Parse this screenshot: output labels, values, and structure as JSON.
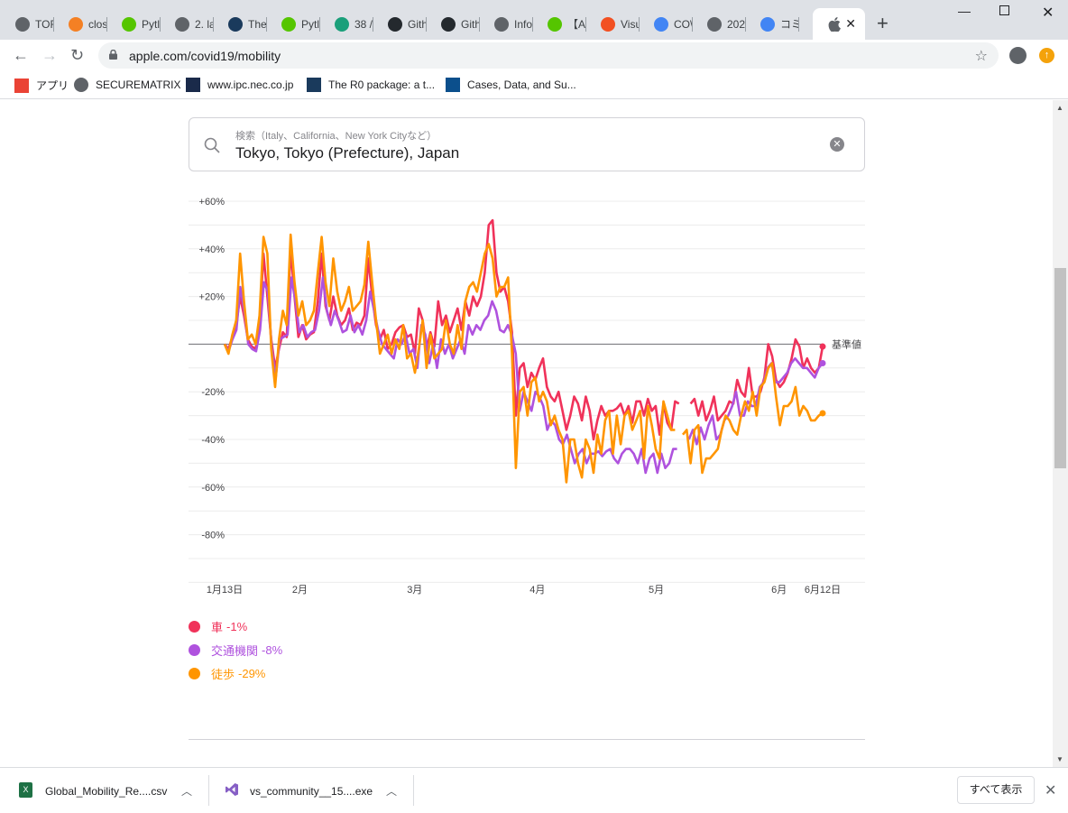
{
  "browser": {
    "tabs": [
      {
        "label": "TOF",
        "icon": "globe-icon",
        "color": "#5f6368"
      },
      {
        "label": "clos",
        "icon": "stackoverflow-icon",
        "color": "#f48024"
      },
      {
        "label": "Pytl",
        "icon": "qiita-icon",
        "color": "#55c500"
      },
      {
        "label": "2. la",
        "icon": "globe-icon",
        "color": "#5f6368"
      },
      {
        "label": "The",
        "icon": "r0-icon",
        "color": "#1a3a5c"
      },
      {
        "label": "Pytl",
        "icon": "qiita-icon",
        "color": "#55c500"
      },
      {
        "label": "38 /",
        "icon": "loading-icon",
        "color": "#1a9f7a"
      },
      {
        "label": "Gith",
        "icon": "github-icon",
        "color": "#24292e"
      },
      {
        "label": "Gith",
        "icon": "github-icon",
        "color": "#24292e"
      },
      {
        "label": "Info",
        "icon": "globe-icon",
        "color": "#5f6368"
      },
      {
        "label": "【Ai",
        "icon": "qiita-icon",
        "color": "#55c500"
      },
      {
        "label": "Visu",
        "icon": "microsoft-icon",
        "color": "#f25022"
      },
      {
        "label": "CO\\",
        "icon": "google-icon",
        "color": "#4285f4"
      },
      {
        "label": "202",
        "icon": "globe-icon",
        "color": "#5f6368"
      },
      {
        "label": "コミ",
        "icon": "google-icon",
        "color": "#4285f4"
      }
    ],
    "active_tab_icon": "apple-icon",
    "url": "apple.com/covid19/mobility",
    "bookmarks": [
      {
        "label": "アプリ",
        "icon": "apps-grid-icon"
      },
      {
        "label": "SECUREMATRIX",
        "icon": "globe-icon"
      },
      {
        "label": "www.ipc.nec.co.jp",
        "icon": "d-icon"
      },
      {
        "label": "The R0 package: a t...",
        "icon": "r0-icon"
      },
      {
        "label": "Cases, Data, and Su...",
        "icon": "cdc-icon"
      }
    ]
  },
  "search": {
    "placeholder": "検索（Italy、California、New York Cityなど）",
    "value": "Tokyo, Tokyo (Prefecture), Japan"
  },
  "chart_data": {
    "type": "line",
    "baseline_label": "基準値",
    "y_ticks": [
      "+60%",
      "+40%",
      "+20%",
      "",
      "-20%",
      "-40%",
      "-60%",
      "-80%"
    ],
    "ylim": [
      -100,
      60
    ],
    "x_ticks": [
      {
        "label": "1月13日",
        "date": "2020-01-13"
      },
      {
        "label": "2月",
        "date": "2020-02-01"
      },
      {
        "label": "3月",
        "date": "2020-03-01"
      },
      {
        "label": "4月",
        "date": "2020-04-01"
      },
      {
        "label": "5月",
        "date": "2020-05-01"
      },
      {
        "label": "6月",
        "date": "2020-06-01"
      },
      {
        "label": "6月12日",
        "date": "2020-06-12"
      }
    ],
    "x_start": "2020-01-13",
    "x_end": "2020-06-12",
    "series": [
      {
        "name": "車",
        "value_label": "-1%",
        "color": "#f0325a",
        "values": [
          0,
          -2,
          3,
          8,
          20,
          12,
          2,
          -1,
          -2,
          8,
          38,
          20,
          2,
          -10,
          -2,
          5,
          3,
          40,
          20,
          3,
          8,
          2,
          4,
          5,
          18,
          38,
          16,
          10,
          20,
          12,
          8,
          10,
          15,
          6,
          9,
          8,
          12,
          36,
          20,
          8,
          2,
          6,
          -2,
          0,
          5,
          7,
          8,
          3,
          4,
          -4,
          15,
          10,
          -2,
          5,
          -1,
          18,
          8,
          12,
          5,
          10,
          15,
          6,
          18,
          12,
          20,
          16,
          20,
          30,
          50,
          52,
          30,
          22,
          24,
          18,
          5,
          -30,
          -10,
          -8,
          -18,
          -12,
          -15,
          -10,
          -6,
          -18,
          -22,
          -24,
          -20,
          -28,
          -36,
          -30,
          -22,
          -25,
          -32,
          -22,
          -28,
          -40,
          -32,
          -26,
          -30,
          -28,
          -28,
          -27,
          -25,
          -30,
          -26,
          -33,
          -24,
          -24,
          -30,
          -23,
          -28,
          -26,
          -38,
          -25,
          -33,
          -36,
          -24,
          -25,
          null,
          null,
          -25,
          -23,
          -30,
          -24,
          -32,
          -28,
          -22,
          -32,
          -30,
          -28,
          -24,
          -25,
          -15,
          -20,
          -22,
          -10,
          -22,
          -22,
          -20,
          -14,
          0,
          -5,
          -15,
          -18,
          -16,
          -12,
          -6,
          2,
          -1,
          -10,
          -6,
          -10,
          -12,
          -10,
          -1
        ]
      },
      {
        "name": "交通機関",
        "value_label": "-8%",
        "color": "#af52de",
        "values": [
          0,
          -3,
          2,
          6,
          24,
          14,
          0,
          -2,
          -3,
          6,
          26,
          22,
          -2,
          -14,
          2,
          3,
          4,
          28,
          18,
          5,
          8,
          3,
          5,
          6,
          14,
          28,
          14,
          8,
          14,
          10,
          5,
          6,
          12,
          5,
          8,
          4,
          10,
          22,
          14,
          6,
          0,
          -2,
          -4,
          -6,
          2,
          0,
          4,
          -4,
          -2,
          -10,
          8,
          4,
          -8,
          0,
          -10,
          2,
          -4,
          0,
          -6,
          -2,
          2,
          -4,
          8,
          4,
          8,
          6,
          10,
          12,
          18,
          14,
          6,
          5,
          8,
          4,
          -4,
          -28,
          -20,
          -24,
          -28,
          -20,
          -22,
          -26,
          -36,
          -32,
          -34,
          -40,
          -42,
          -38,
          -44,
          -50,
          -46,
          -44,
          -50,
          -46,
          -46,
          -45,
          -47,
          -45,
          -44,
          -48,
          -50,
          -46,
          -44,
          -44,
          -46,
          -50,
          -44,
          -54,
          -48,
          -46,
          -54,
          -46,
          -52,
          -50,
          -44,
          -44,
          null,
          null,
          -40,
          -36,
          -42,
          -35,
          -40,
          -34,
          -30,
          -40,
          -38,
          -32,
          -30,
          -26,
          -20,
          -30,
          -30,
          -24,
          -26,
          -26,
          -18,
          -16,
          -10,
          -8,
          -16,
          -16,
          -14,
          -12,
          -8,
          -6,
          -8,
          -10,
          -10,
          -12,
          -14,
          -10,
          -8
        ]
      },
      {
        "name": "徒歩",
        "value_label": "-29%",
        "color": "#ff9500",
        "values": [
          0,
          -4,
          4,
          10,
          38,
          18,
          2,
          4,
          0,
          12,
          45,
          38,
          -2,
          -18,
          2,
          14,
          8,
          46,
          26,
          12,
          18,
          8,
          10,
          14,
          30,
          45,
          26,
          16,
          36,
          22,
          14,
          18,
          24,
          14,
          16,
          18,
          25,
          43,
          26,
          10,
          -4,
          0,
          4,
          -4,
          2,
          -2,
          8,
          -6,
          -4,
          -12,
          -2,
          10,
          -10,
          4,
          -6,
          -4,
          -2,
          10,
          0,
          -4,
          8,
          -2,
          18,
          24,
          26,
          22,
          30,
          38,
          42,
          36,
          20,
          24,
          24,
          28,
          -4,
          -52,
          -20,
          -18,
          -30,
          -16,
          -14,
          -24,
          -20,
          -24,
          -34,
          -30,
          -36,
          -40,
          -58,
          -40,
          -40,
          -50,
          -56,
          -40,
          -44,
          -54,
          -38,
          -46,
          -32,
          -28,
          -46,
          -30,
          -42,
          -30,
          -28,
          -36,
          -32,
          -28,
          -48,
          -26,
          -34,
          -44,
          -48,
          -24,
          -30,
          -36,
          -36,
          null,
          -38,
          -36,
          -50,
          -36,
          -34,
          -54,
          -48,
          -48,
          -46,
          -44,
          -36,
          -30,
          -32,
          -36,
          -38,
          -30,
          -24,
          -28,
          -20,
          -30,
          -18,
          -16,
          -10,
          -8,
          -22,
          -34,
          -26,
          -26,
          -24,
          -18,
          -30,
          -26,
          -28,
          -32,
          -32,
          -30,
          -29
        ]
      }
    ]
  },
  "downloads": [
    {
      "name": "Global_Mobility_Re....csv",
      "icon": "excel-icon"
    },
    {
      "name": "vs_community__15....exe",
      "icon": "visual-studio-icon"
    }
  ],
  "show_all_label": "すべて表示"
}
